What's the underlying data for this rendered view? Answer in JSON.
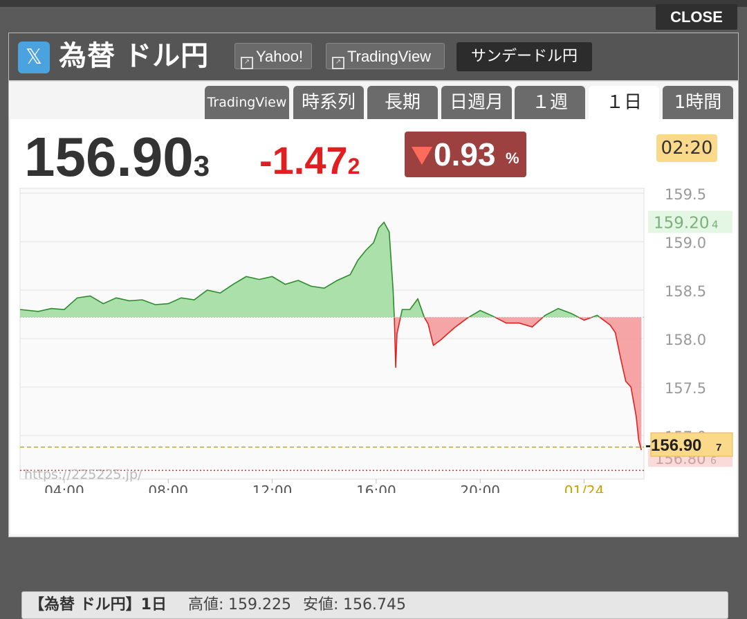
{
  "window": {
    "close_label": "CLOSE"
  },
  "header": {
    "logo": "𝕏",
    "title": "為替 ドル円",
    "links": [
      "Yahoo!",
      "TradingView"
    ],
    "sunday_button": "サンデードル円"
  },
  "tabs": [
    {
      "label": "TradingView",
      "active": false
    },
    {
      "label": "時系列",
      "active": false
    },
    {
      "label": "長期",
      "active": false
    },
    {
      "label": "日週月",
      "active": false
    },
    {
      "label": "１週",
      "active": false
    },
    {
      "label": "１日",
      "active": true
    },
    {
      "label": "1時間",
      "active": false
    }
  ],
  "quote": {
    "price_main": "156.90",
    "price_sub": "3",
    "change_main": "-1.47",
    "change_sub": "2",
    "percent": "0.93",
    "percent_unit": "%",
    "time": "02:20"
  },
  "watermark": "https://225225.jp/",
  "colors": {
    "up": "#2d8a2d",
    "up_fill": "#a6dea6",
    "down": "#e02020",
    "down_fill": "#f4a0a0",
    "accent": "#fbd98a"
  },
  "chart_data": {
    "type": "area",
    "yticks": [
      "159.5",
      "159.0",
      "158.5",
      "158.0",
      "157.5",
      "157.0"
    ],
    "xticks": [
      "04:00",
      "08:00",
      "12:00",
      "16:00",
      "20:00",
      "01/24"
    ],
    "ylim": [
      156.55,
      159.55
    ],
    "xlim": [
      2.3,
      26.3
    ],
    "baseline": 158.22,
    "high_marker": {
      "main": "159.20",
      "sub": "4"
    },
    "current_marker": {
      "main": "156.90",
      "sub": "7",
      "value": 156.907
    },
    "low_marker": {
      "main": "156.80",
      "sub": "6",
      "value": 156.806
    },
    "dashed_line_value": 156.88,
    "dotted_line_value": 156.64,
    "x": [
      2.3,
      3.0,
      3.5,
      4.0,
      4.5,
      5.0,
      5.5,
      6.0,
      6.5,
      7.0,
      7.5,
      8.0,
      8.5,
      9.0,
      9.5,
      10.0,
      10.5,
      11.0,
      11.5,
      12.0,
      12.5,
      13.0,
      13.5,
      14.0,
      14.5,
      15.0,
      15.3,
      15.6,
      15.9,
      16.1,
      16.3,
      16.5,
      16.65,
      16.7,
      16.75,
      16.8,
      17.0,
      17.3,
      17.6,
      17.85,
      18.0,
      18.2,
      18.5,
      19.0,
      19.5,
      20.0,
      20.5,
      21.0,
      21.5,
      22.0,
      22.5,
      23.0,
      23.5,
      24.0,
      24.5,
      25.0,
      25.2,
      25.4,
      25.6,
      25.8,
      26.0,
      26.1,
      26.2
    ],
    "y": [
      158.3,
      158.28,
      158.31,
      158.3,
      158.42,
      158.44,
      158.36,
      158.42,
      158.39,
      158.4,
      158.35,
      158.36,
      158.42,
      158.4,
      158.5,
      158.47,
      158.56,
      158.64,
      158.61,
      158.64,
      158.56,
      158.6,
      158.54,
      158.52,
      158.6,
      158.66,
      158.81,
      158.91,
      158.99,
      159.14,
      159.2,
      159.1,
      158.5,
      158.2,
      157.7,
      158.05,
      158.3,
      158.3,
      158.41,
      158.22,
      158.15,
      157.93,
      157.99,
      158.11,
      158.21,
      158.29,
      158.23,
      158.16,
      158.16,
      158.12,
      158.24,
      158.31,
      158.26,
      158.19,
      158.24,
      158.14,
      158.06,
      157.8,
      157.56,
      157.5,
      157.2,
      156.95,
      156.85
    ]
  },
  "stats": {
    "label": "【為替 ドル円】1日",
    "high_label": "高値:",
    "high_value": "159.225",
    "low_label": "安値:",
    "low_value": "156.745"
  }
}
